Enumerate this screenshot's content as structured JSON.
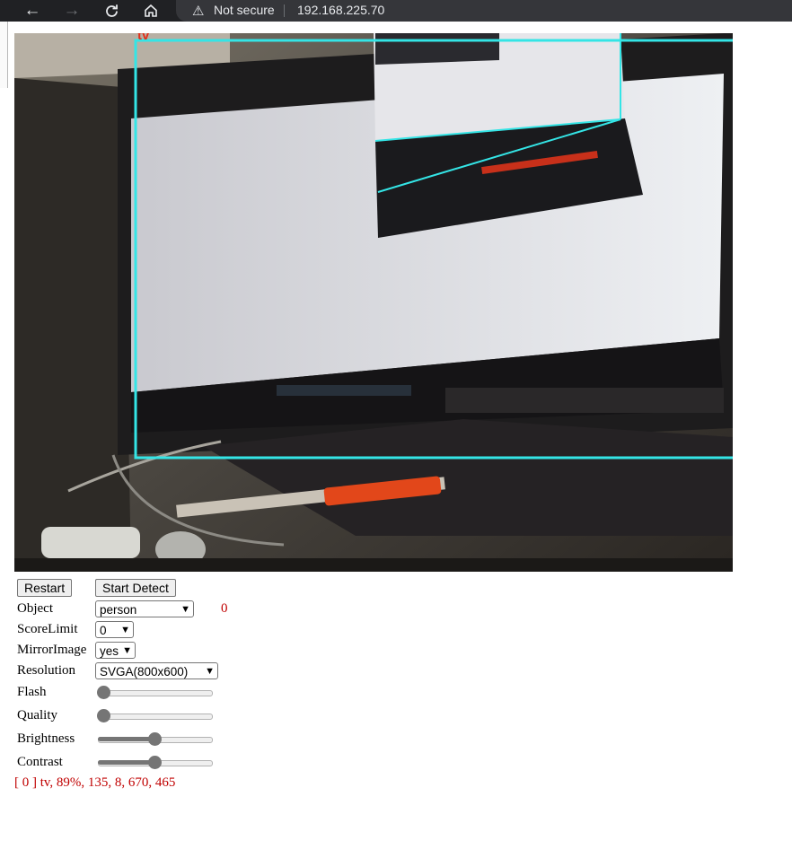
{
  "browser": {
    "security_label": "Not secure",
    "address": "192.168.225.70",
    "nav_icons": [
      "back-arrow-icon",
      "forward-arrow-icon",
      "reload-icon",
      "home-icon",
      "warning-icon"
    ]
  },
  "stream": {
    "detection_label": "tv",
    "box_color": "#34e5e6"
  },
  "buttons": {
    "restart": "Restart",
    "start_detect": "Start Detect"
  },
  "controls": {
    "object": {
      "label": "Object",
      "value": "person",
      "count": "0"
    },
    "score_limit": {
      "label": "ScoreLimit",
      "value": "0"
    },
    "mirror_image": {
      "label": "MirrorImage",
      "value": "yes"
    },
    "resolution": {
      "label": "Resolution",
      "value": "SVGA(800x600)"
    },
    "flash": {
      "label": "Flash",
      "level": 0
    },
    "quality": {
      "label": "Quality",
      "level": 0
    },
    "brightness": {
      "label": "Brightness",
      "level": 0.5
    },
    "contrast": {
      "label": "Contrast",
      "level": 0.5
    }
  },
  "result_line": "[ 0 ] tv, 89%, 135, 8, 670, 465",
  "colors": {
    "result_red": "#c00000",
    "count_red": "#c00000"
  }
}
